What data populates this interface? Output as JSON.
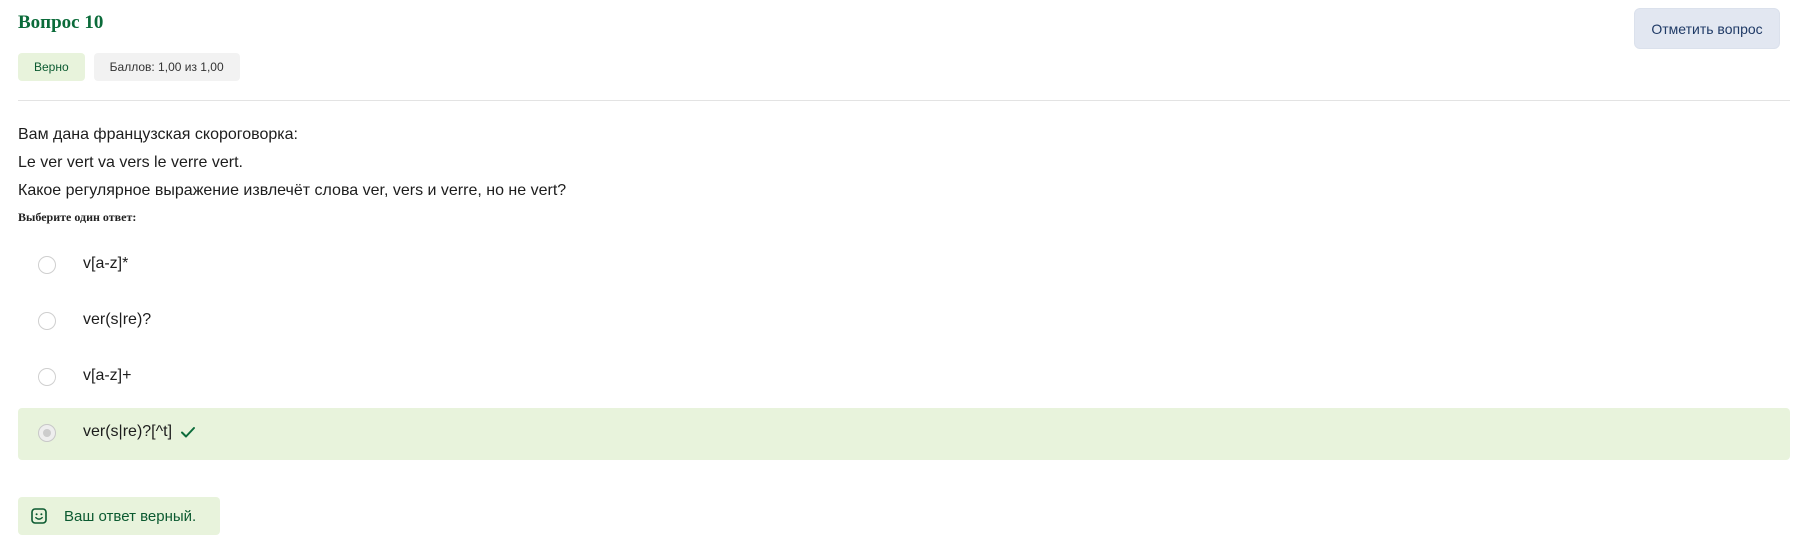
{
  "question": {
    "title": "Вопрос 10",
    "flag_label": "Отметить вопрос",
    "state_badge": "Верно",
    "grade_badge": "Баллов: 1,00 из 1,00",
    "text_lines": [
      "Вам дана французская скороговорка:",
      "Le ver vert va vers le verre vert.",
      "Какое регулярное выражение извлечёт слова ver, vers и verre, но не vert?"
    ],
    "prompt": "Выберите один ответ:",
    "answers": [
      {
        "label": "v[a-z]*",
        "selected": false
      },
      {
        "label": "ver(s|re)?",
        "selected": false
      },
      {
        "label": "v[a-z]+",
        "selected": false
      },
      {
        "label": "ver(s|re)?[^t]",
        "selected": true,
        "correct": true
      }
    ],
    "feedback": "Ваш ответ верный."
  },
  "colors": {
    "title": "#0b6b3a",
    "correct_bg": "#e8f3dc",
    "flag_bg": "#e2e7f1"
  },
  "icons": {
    "check": "check-icon",
    "feedback": "smile-icon"
  }
}
